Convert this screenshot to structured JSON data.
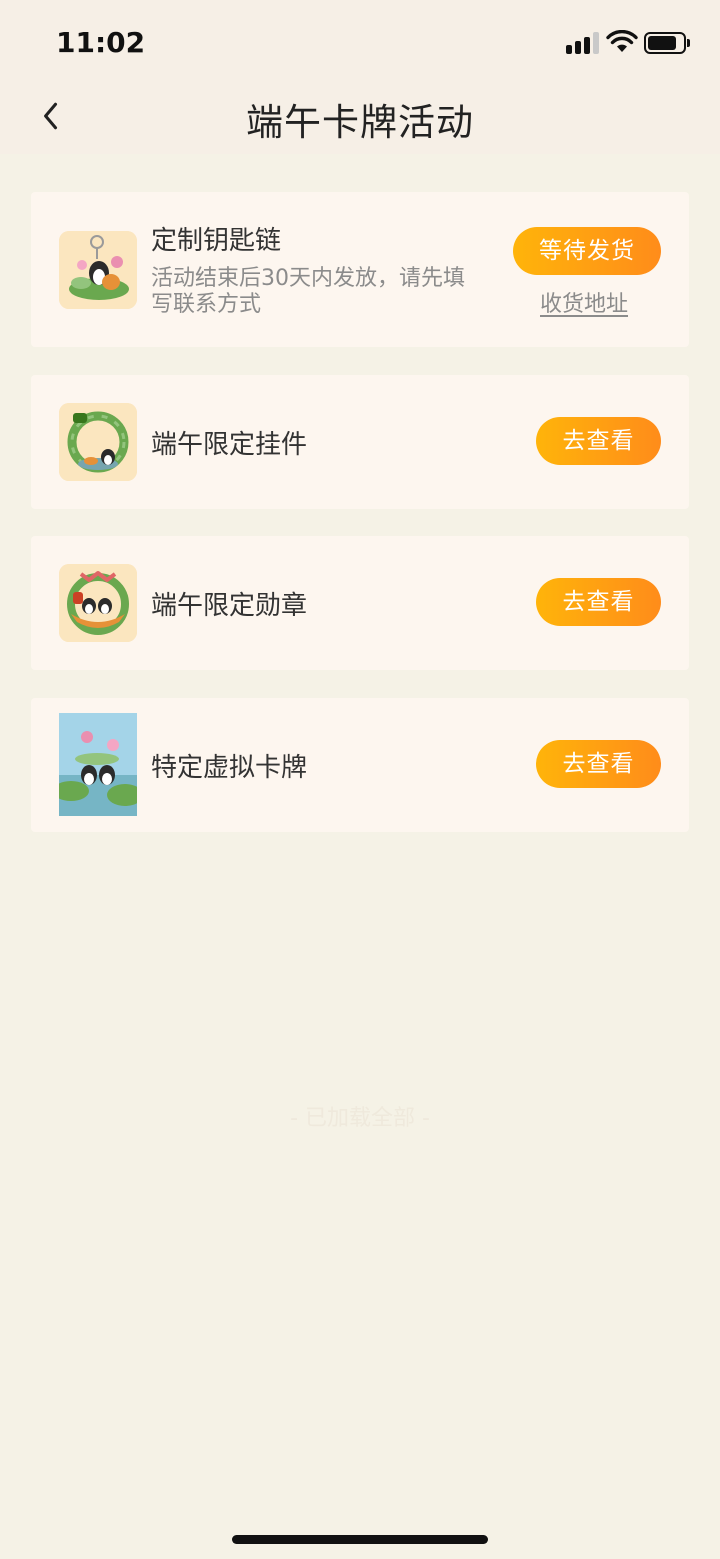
{
  "status_bar": {
    "time": "11:02"
  },
  "header": {
    "title": "端午卡牌活动"
  },
  "items": [
    {
      "title": "定制钥匙链",
      "description": "活动结束后30天内发放，请先填写联系方式",
      "button_label": "等待发货",
      "link_label": "收货地址",
      "thumbnail_icon": "keychain-icon"
    },
    {
      "title": "端午限定挂件",
      "button_label": "去查看",
      "thumbnail_icon": "wreath-pendant-icon"
    },
    {
      "title": "端午限定勋章",
      "button_label": "去查看",
      "thumbnail_icon": "dragon-boat-medal-icon"
    },
    {
      "title": "特定虚拟卡牌",
      "button_label": "去查看",
      "thumbnail_icon": "virtual-card-icon"
    }
  ],
  "footer": {
    "note": "- 已加载全部 -"
  },
  "colors": {
    "button_gradient_start": "#ffb40a",
    "button_gradient_end": "#ff8c1a",
    "page_background": "#f5f2e6",
    "card_background": "#fdf6ef"
  }
}
